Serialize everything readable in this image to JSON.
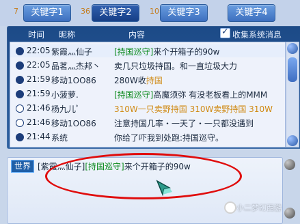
{
  "tabs": [
    {
      "num": "7",
      "label": "关键字1",
      "active": false
    },
    {
      "num": "36",
      "label": "关键字2",
      "active": true
    },
    {
      "num": "10",
      "label": "关键字3",
      "active": false
    },
    {
      "num": "",
      "label": "关键字4",
      "active": false
    }
  ],
  "columns": {
    "time": "时间",
    "nick": "昵称",
    "content": "内容",
    "collect_label": "收集系统消息"
  },
  "messages": [
    {
      "marker": "filled",
      "time": "22:05",
      "nick": "紫霞灬仙子",
      "parts": [
        {
          "t": "[持国巡守]",
          "c": "green"
        },
        {
          "t": "来个开箱子的90w",
          "c": "normal"
        }
      ]
    },
    {
      "marker": "filled",
      "time": "22:05",
      "nick": "品茗灬杰邦丶",
      "parts": [
        {
          "t": "卖几只垃圾持国。和一直垃圾大力",
          "c": "normal"
        }
      ]
    },
    {
      "marker": "filled",
      "time": "21:59",
      "nick": "移动1OO86",
      "parts": [
        {
          "t": "280W收",
          "c": "normal"
        },
        {
          "t": "持国",
          "c": "orange"
        }
      ]
    },
    {
      "marker": "filled",
      "time": "21:59",
      "nick": "小菠萝.",
      "parts": [
        {
          "t": "[持国巡守]",
          "c": "green"
        },
        {
          "t": "高魔须弥 有没老板看上的MMM",
          "c": "normal"
        }
      ]
    },
    {
      "marker": "hollow",
      "time": "21:46",
      "nick": "杨九儿ﾟ",
      "parts": [
        {
          "t": "310W一只卖野持国 310W卖野持国 310W",
          "c": "orange"
        }
      ]
    },
    {
      "marker": "hollow",
      "time": "21:46",
      "nick": "移动1OO86",
      "parts": [
        {
          "t": "注意持国几率・一天了・一只都没遇到",
          "c": "normal"
        }
      ]
    },
    {
      "marker": "filled",
      "time": "21:44",
      "nick": "系统",
      "parts": [
        {
          "t": "你给了吓我到处跑:持国巡守。",
          "c": "normal"
        }
      ]
    }
  ],
  "input": {
    "channel": "世界",
    "text": "[紫霞灬仙子][持国巡守]来个开箱子的90w"
  },
  "watermark": "小二梦幻西游",
  "colors": {
    "accent": "#1f4c8f",
    "highlight_green": "#0c8a1d",
    "highlight_orange": "#d08a14",
    "annotation_red": "#e00d0d"
  }
}
